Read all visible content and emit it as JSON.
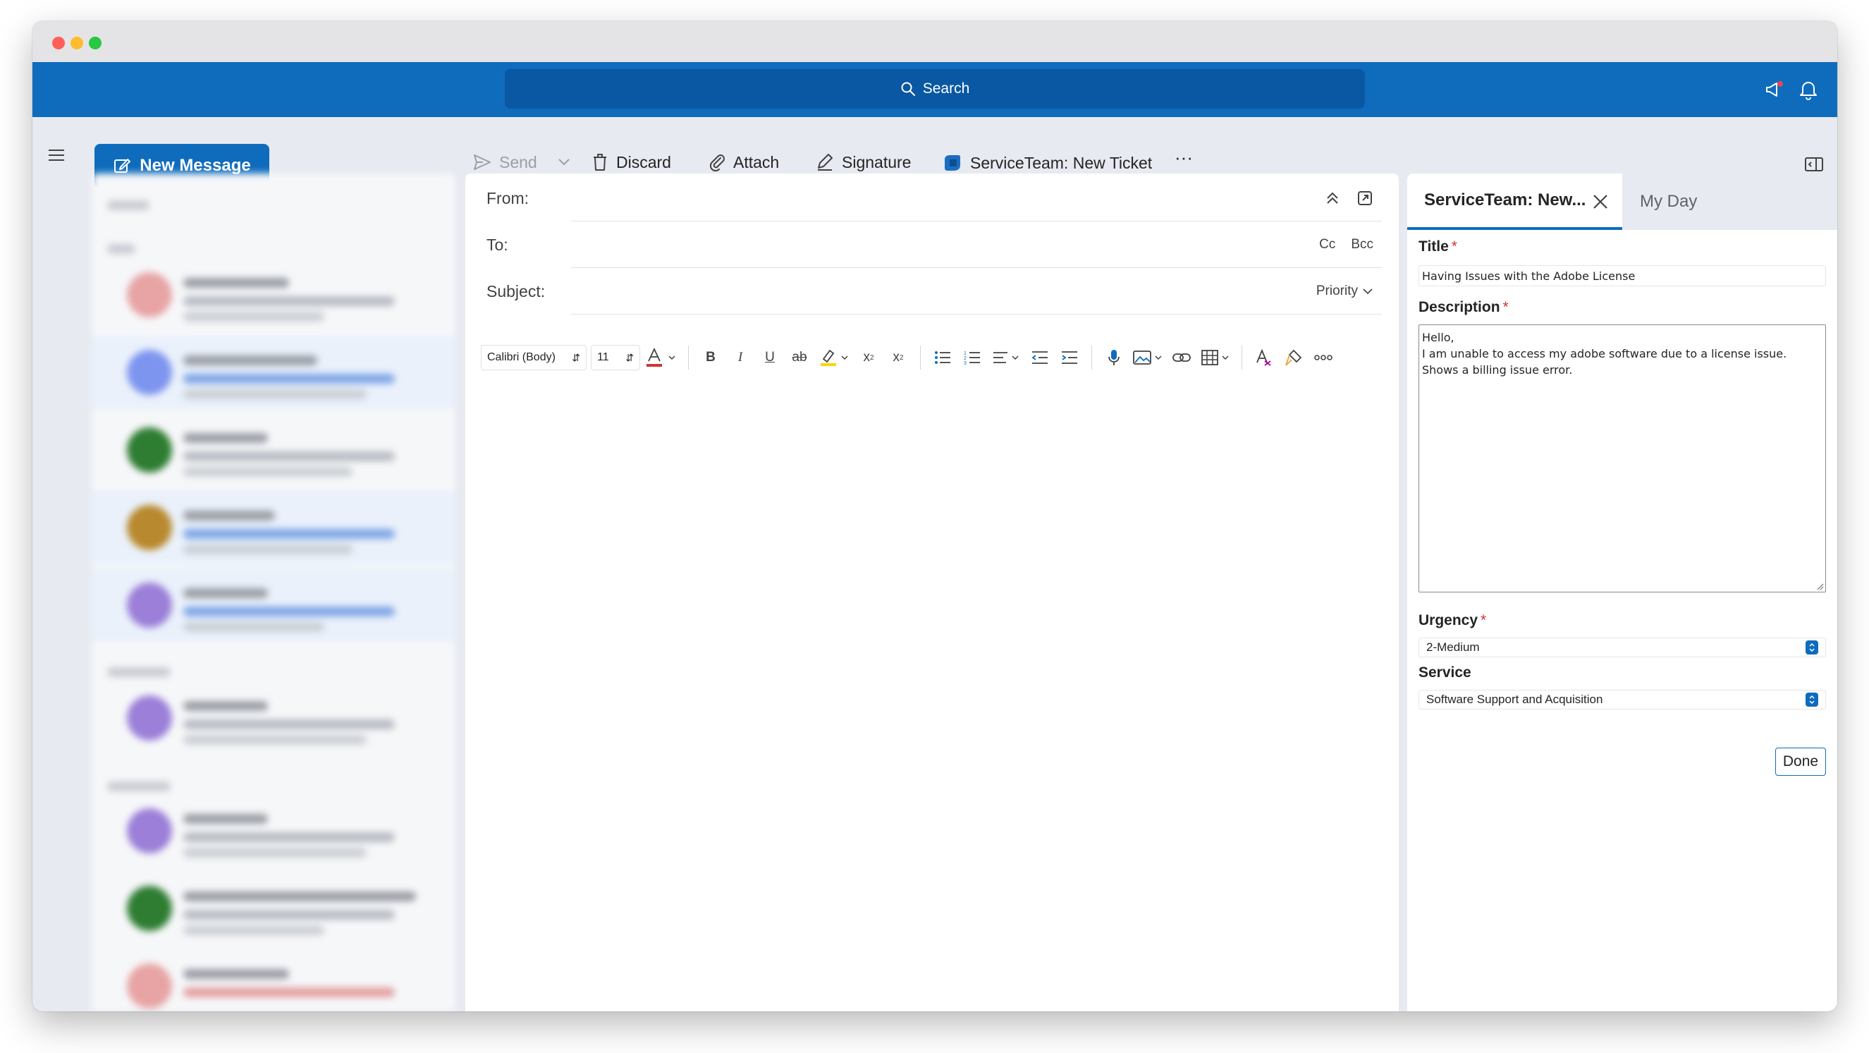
{
  "search": {
    "label": "Search"
  },
  "colors": {
    "brand": "#0f6cbd",
    "required": "#d13438"
  },
  "toolbar": {
    "new_message": "New Message",
    "send": "Send",
    "discard": "Discard",
    "attach": "Attach",
    "signature": "Signature",
    "serviceteam": "ServiceTeam: New Ticket",
    "more": "···"
  },
  "compose": {
    "from_label": "From:",
    "to_label": "To:",
    "subject_label": "Subject:",
    "cc": "Cc",
    "bcc": "Bcc",
    "priority": "Priority",
    "font_name": "Calibri (Body)",
    "font_size": "11"
  },
  "side_panel": {
    "active_tab": "ServiceTeam: New...",
    "other_tab": "My Day",
    "title_label": "Title",
    "title_value": "Having Issues with the Adobe License",
    "description_label": "Description",
    "description_line1": "Hello,",
    "description_line2": "I am unable to access my adobe software due to a license issue. Shows a billing issue error.",
    "urgency_label": "Urgency",
    "urgency_value": "2-Medium",
    "service_label": "Service",
    "service_value": "Software Support and Acquisition",
    "done": "Done",
    "required_mark": "*"
  }
}
